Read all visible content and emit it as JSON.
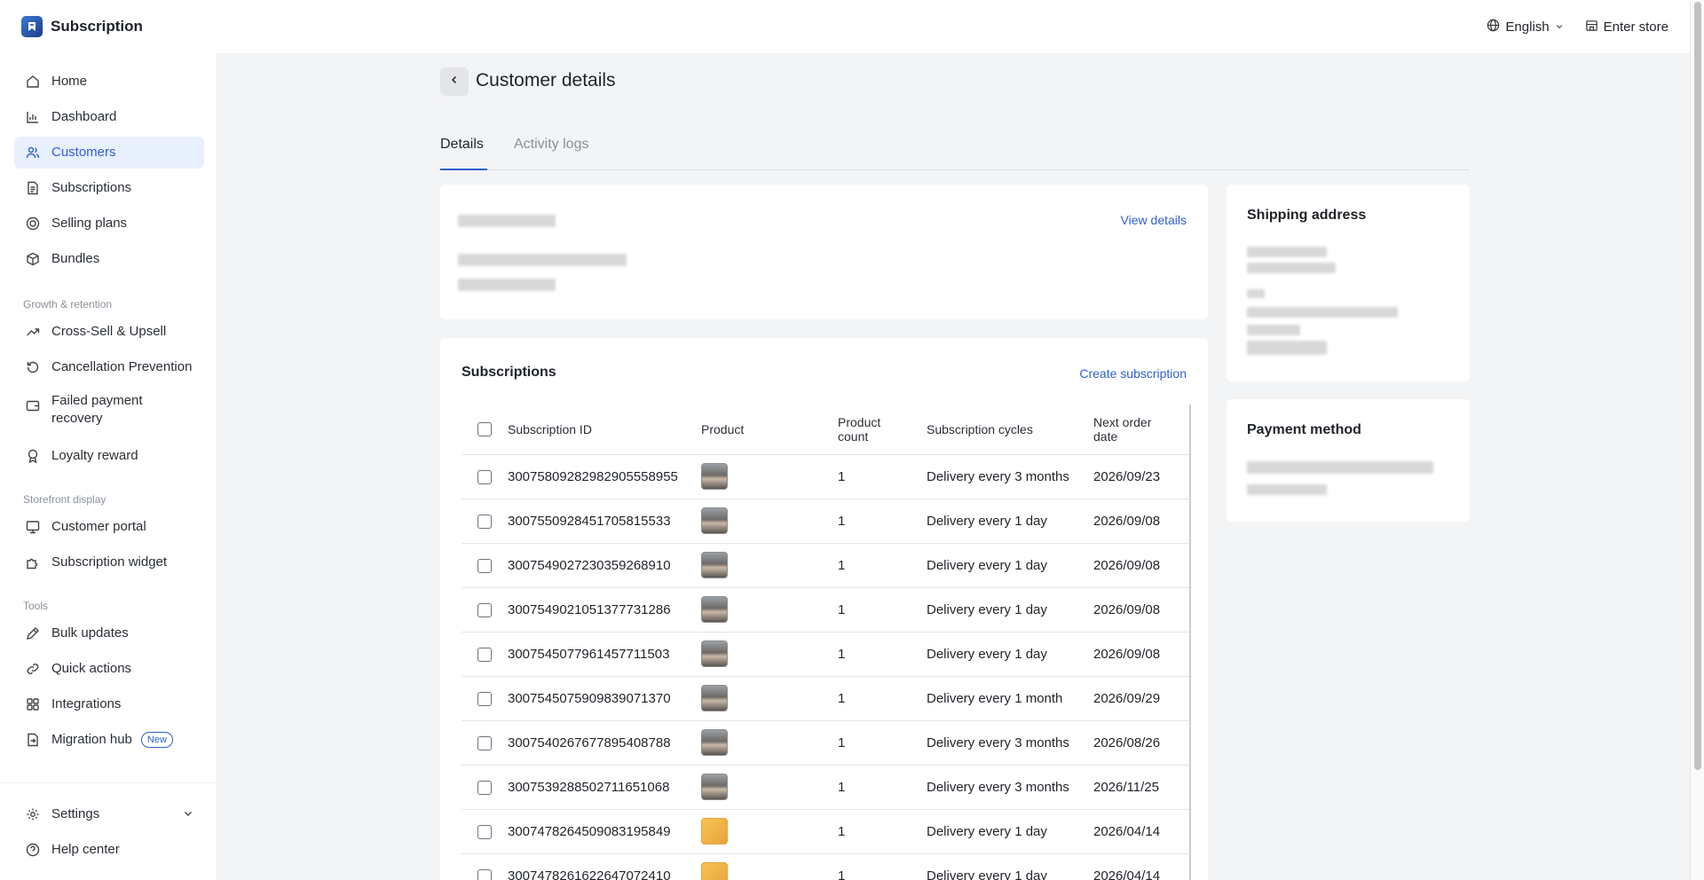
{
  "app": {
    "title": "Subscription",
    "logo_icon": "app-logo-icon"
  },
  "topbar": {
    "language": "English",
    "enter_store": "Enter store"
  },
  "sidebar": {
    "items": [
      {
        "label": "Home",
        "icon": "home-icon"
      },
      {
        "label": "Dashboard",
        "icon": "bar-chart-icon"
      },
      {
        "label": "Customers",
        "icon": "users-icon",
        "active": true
      },
      {
        "label": "Subscriptions",
        "icon": "document-icon"
      },
      {
        "label": "Selling plans",
        "icon": "target-icon"
      },
      {
        "label": "Bundles",
        "icon": "box-icon"
      }
    ],
    "growth_label": "Growth & retention",
    "growth_items": [
      {
        "label": "Cross-Sell & Upsell",
        "icon": "trend-up-icon"
      },
      {
        "label": "Cancellation Prevention",
        "icon": "refresh-icon"
      },
      {
        "label": "Failed payment recovery",
        "icon": "wallet-icon"
      },
      {
        "label": "Loyalty reward",
        "icon": "award-icon"
      }
    ],
    "storefront_label": "Storefront display",
    "storefront_items": [
      {
        "label": "Customer portal",
        "icon": "monitor-icon"
      },
      {
        "label": "Subscription widget",
        "icon": "puzzle-icon"
      }
    ],
    "tools_label": "Tools",
    "tools_items": [
      {
        "label": "Bulk updates",
        "icon": "pen-icon"
      },
      {
        "label": "Quick actions",
        "icon": "link-icon"
      },
      {
        "label": "Integrations",
        "icon": "grid-icon"
      },
      {
        "label": "Migration hub",
        "icon": "import-icon",
        "badge": "New"
      }
    ],
    "settings": "Settings",
    "help": "Help center"
  },
  "page": {
    "title": "Customer details"
  },
  "tabs": [
    {
      "label": "Details",
      "active": true
    },
    {
      "label": "Activity logs",
      "active": false
    }
  ],
  "customer_card": {
    "view_details": "View details"
  },
  "subscriptions": {
    "title": "Subscriptions",
    "create_label": "Create subscription",
    "columns": [
      "Subscription ID",
      "Product",
      "Product count",
      "Subscription cycles",
      "Next order date"
    ],
    "rows": [
      {
        "id": "30075809282982905558955",
        "thumb": "gray",
        "count": "1",
        "cycle": "Delivery every 3 months",
        "next": "2026/09/23"
      },
      {
        "id": "3007550928451705815533",
        "thumb": "gray",
        "count": "1",
        "cycle": "Delivery every 1 day",
        "next": "2026/09/08"
      },
      {
        "id": "3007549027230359268910",
        "thumb": "gray",
        "count": "1",
        "cycle": "Delivery every 1 day",
        "next": "2026/09/08"
      },
      {
        "id": "3007549021051377731286",
        "thumb": "gray",
        "count": "1",
        "cycle": "Delivery every 1 day",
        "next": "2026/09/08"
      },
      {
        "id": "3007545077961457711503",
        "thumb": "gray",
        "count": "1",
        "cycle": "Delivery every 1 day",
        "next": "2026/09/08"
      },
      {
        "id": "3007545075909839071370",
        "thumb": "gray",
        "count": "1",
        "cycle": "Delivery every 1 month",
        "next": "2026/09/29"
      },
      {
        "id": "3007540267677895408788",
        "thumb": "gray",
        "count": "1",
        "cycle": "Delivery every 3 months",
        "next": "2026/08/26"
      },
      {
        "id": "3007539288502711651068",
        "thumb": "gray",
        "count": "1",
        "cycle": "Delivery every 3 months",
        "next": "2026/11/25"
      },
      {
        "id": "3007478264509083195849",
        "thumb": "yellow",
        "count": "1",
        "cycle": "Delivery every 1 day",
        "next": "2026/04/14"
      },
      {
        "id": "3007478261622647072410",
        "thumb": "yellow",
        "count": "1",
        "cycle": "Delivery every 1 day",
        "next": "2026/04/14"
      }
    ]
  },
  "shipping": {
    "title": "Shipping address"
  },
  "payment": {
    "title": "Payment method"
  }
}
